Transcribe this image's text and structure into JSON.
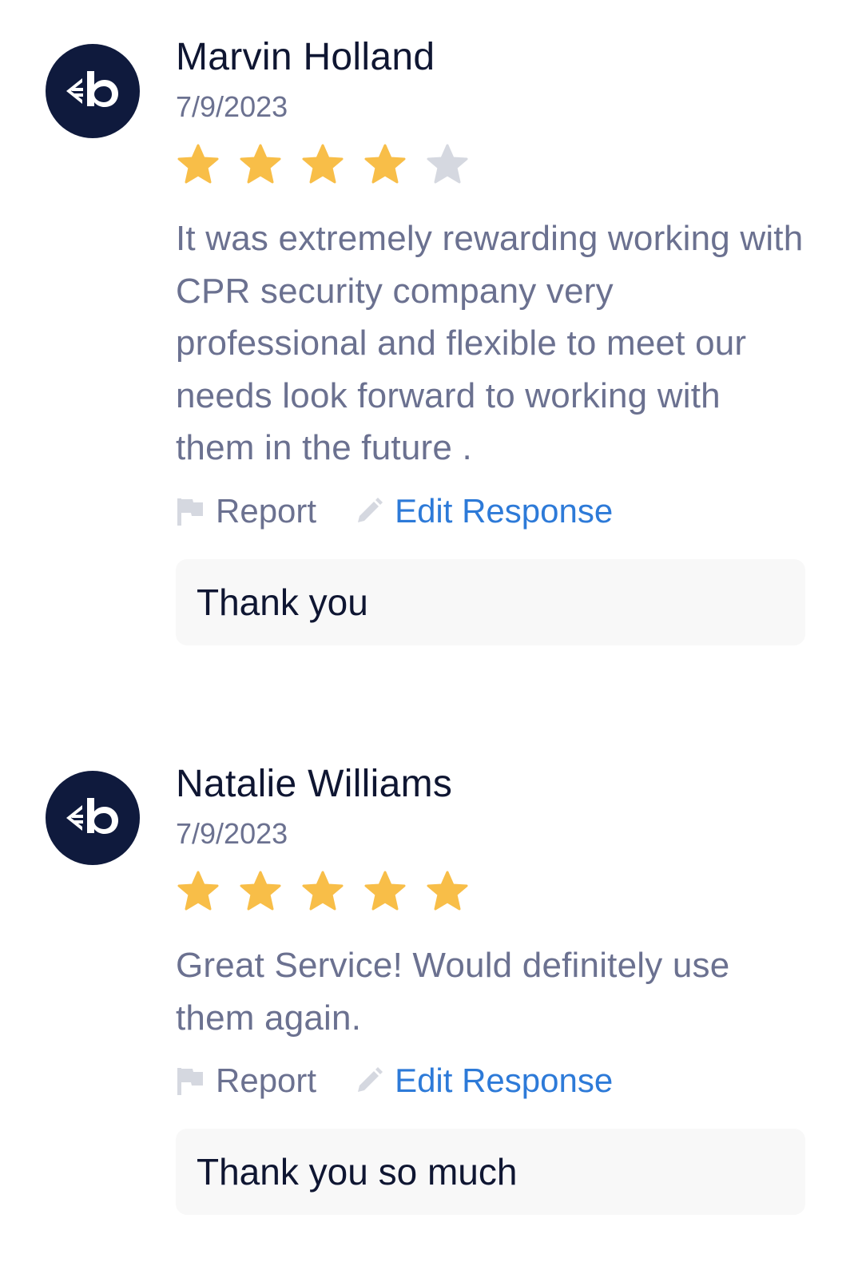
{
  "reviews": [
    {
      "avatar_icon": "business-logo-icon",
      "name": "Marvin Holland",
      "date": "7/9/2023",
      "rating": 4,
      "max_rating": 5,
      "text": "It was extremely rewarding working with CPR security company very professional and flexible to meet our needs look forward to working with them in the future .",
      "report_label": "Report",
      "edit_label": "Edit Response",
      "response": "Thank you"
    },
    {
      "avatar_icon": "business-logo-icon",
      "name": "Natalie Williams",
      "date": "7/9/2023",
      "rating": 5,
      "max_rating": 5,
      "text": "Great Service! Would definitely use them again.",
      "report_label": "Report",
      "edit_label": "Edit Response",
      "response": "Thank you so much"
    }
  ],
  "colors": {
    "star_filled": "#f8be48",
    "star_empty": "#d5d8e0",
    "link": "#2d7ad8",
    "avatar_bg": "#0f1a3d"
  }
}
